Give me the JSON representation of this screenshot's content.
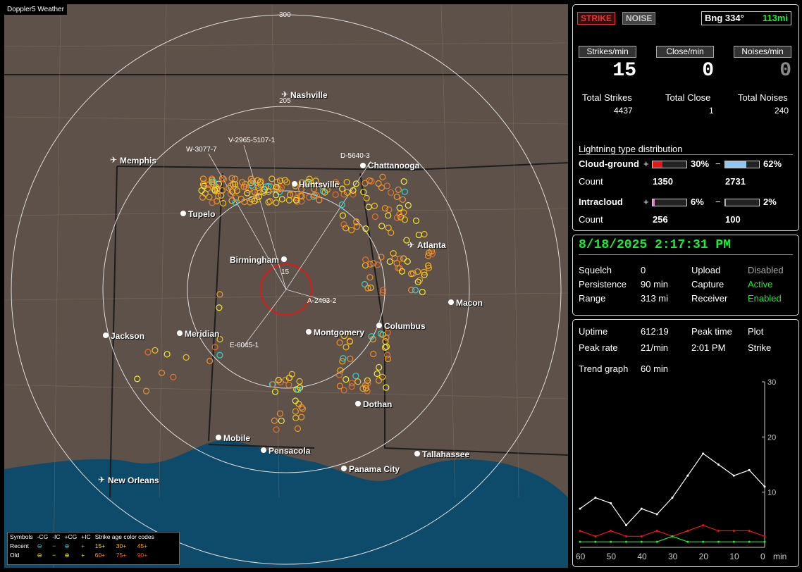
{
  "map": {
    "title": "Doppler5 Weather",
    "ring_labels": [
      "300",
      "205",
      "15"
    ],
    "cities": [
      {
        "name": "Nashville",
        "icon": "plane-icon"
      },
      {
        "name": "Memphis",
        "icon": "plane-icon"
      },
      {
        "name": "Chattanooga",
        "icon": "dot"
      },
      {
        "name": "Huntsville",
        "icon": "dot"
      },
      {
        "name": "Tupelo",
        "icon": "dot"
      },
      {
        "name": "Atlanta",
        "icon": "plane-icon"
      },
      {
        "name": "Birmingham",
        "icon": "dot"
      },
      {
        "name": "Macon",
        "icon": "dot"
      },
      {
        "name": "Jackson",
        "icon": "dot"
      },
      {
        "name": "Meridian",
        "icon": "dot"
      },
      {
        "name": "Montgomery",
        "icon": "dot"
      },
      {
        "name": "Columbus",
        "icon": "dot"
      },
      {
        "name": "Dothan",
        "icon": "dot"
      },
      {
        "name": "Mobile",
        "icon": "dot"
      },
      {
        "name": "Pensacola",
        "icon": "dot"
      },
      {
        "name": "Tallahassee",
        "icon": "dot"
      },
      {
        "name": "Panama City",
        "icon": "dot"
      },
      {
        "name": "New Orleans",
        "icon": "plane-icon"
      }
    ],
    "vectors": [
      "V-2965-5107-1",
      "W-3077-7",
      "D-5640-3",
      "A-2403-2",
      "E-6045-1"
    ],
    "legend": {
      "symbols_label": "Symbols",
      "cols": [
        "-CG",
        "-IC",
        "+CG",
        "+IC"
      ],
      "age_label": "Strike age color codes",
      "recent_label": "Recent",
      "old_label": "Old",
      "recent_ages": [
        "15+",
        "30+",
        "45+"
      ],
      "old_ages": [
        "60+",
        "75+",
        "90+"
      ]
    }
  },
  "status": {
    "strike_label": "STRIKE",
    "noise_label": "NOISE",
    "bearing": "Bng 334°",
    "distance": "113mi",
    "strikes_min_label": "Strikes/min",
    "close_min_label": "Close/min",
    "noises_min_label": "Noises/min",
    "strikes_min": "15",
    "close_min": "0",
    "noises_min": "0",
    "total_strikes_label": "Total Strikes",
    "total_close_label": "Total Close",
    "total_noises_label": "Total Noises",
    "total_strikes": "4437",
    "total_close": "1",
    "total_noises": "240",
    "dist_title": "Lightning type distribution",
    "cg_label": "Cloud-ground",
    "cg_plus_pct": "30%",
    "cg_minus_pct": "62%",
    "cg_plus_fraction": 0.3,
    "cg_minus_fraction": 0.62,
    "count_label": "Count",
    "cg_plus_count": "1350",
    "cg_minus_count": "2731",
    "ic_label": "Intracloud",
    "ic_plus_pct": "6%",
    "ic_minus_pct": "2%",
    "ic_plus_fraction": 0.06,
    "ic_minus_fraction": 0.02,
    "ic_plus_count": "256",
    "ic_minus_count": "100",
    "plus": "+",
    "minus": "−"
  },
  "settings": {
    "datetime": "8/18/2025 2:17:31 PM",
    "squelch_label": "Squelch",
    "squelch": "0",
    "upload_label": "Upload",
    "upload": "Disabled",
    "persistence_label": "Persistence",
    "persistence": "90 min",
    "capture_label": "Capture",
    "capture": "Active",
    "range_label": "Range",
    "range": "313 mi",
    "receiver_label": "Receiver",
    "receiver": "Enabled"
  },
  "trend": {
    "uptime_label": "Uptime",
    "uptime": "612:19",
    "peak_time_label": "Peak time",
    "peak_time": "2:01 PM",
    "plot_label": "Plot",
    "plot": "Strike",
    "peak_rate_label": "Peak rate",
    "peak_rate": "21/min",
    "trend_graph_label": "Trend graph",
    "trend_graph": "60 min",
    "x_ticks": [
      "60",
      "50",
      "40",
      "30",
      "20",
      "10",
      "0"
    ],
    "x_unit": "min",
    "y_ticks": [
      "30",
      "20",
      "10"
    ]
  },
  "chart_data": {
    "type": "line",
    "xlabel": "min",
    "ylabel": "",
    "xlim": [
      60,
      0
    ],
    "ylim": [
      0,
      30
    ],
    "x": [
      60,
      55,
      50,
      45,
      40,
      35,
      30,
      25,
      20,
      15,
      10,
      5,
      0
    ],
    "series": [
      {
        "values": [
          7,
          9,
          8,
          4,
          7,
          6,
          9,
          13,
          17,
          15,
          13,
          14,
          11
        ]
      },
      {
        "values": [
          3,
          2,
          3,
          2,
          2,
          3,
          2,
          3,
          4,
          3,
          3,
          3,
          2
        ]
      },
      {
        "values": [
          1,
          1,
          1,
          1,
          1,
          1,
          2,
          1,
          1,
          1,
          1,
          1,
          1
        ]
      }
    ]
  },
  "colors": {
    "accent_green": "#1eea3a",
    "strike_red": "#e01818",
    "map_bg": "#5d514a",
    "water": "#0e4a6a"
  }
}
